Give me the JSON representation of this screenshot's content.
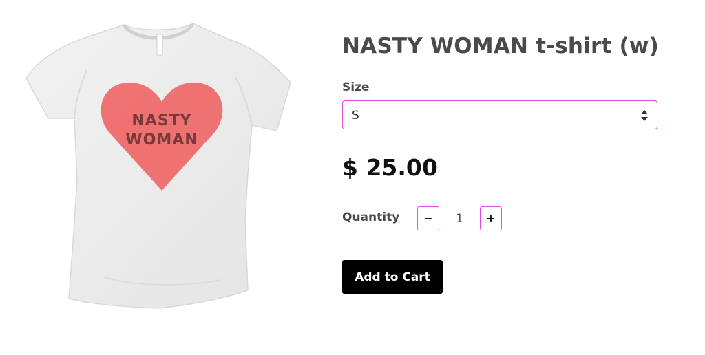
{
  "product": {
    "title": "NASTY WOMAN t-shirt (w)",
    "image_print_line1": "NASTY",
    "image_print_line2": "WOMAN",
    "price": "$ 25.00"
  },
  "size": {
    "label": "Size",
    "selected": "S"
  },
  "quantity": {
    "label": "Quantity",
    "value": "1",
    "minus_label": "−",
    "plus_label": "+"
  },
  "cart": {
    "button_label": "Add to Cart"
  },
  "colors": {
    "accent_border": "#e24de8",
    "heart": "#ef6b6b",
    "button_bg": "#000000",
    "shirt": "#ececec"
  }
}
